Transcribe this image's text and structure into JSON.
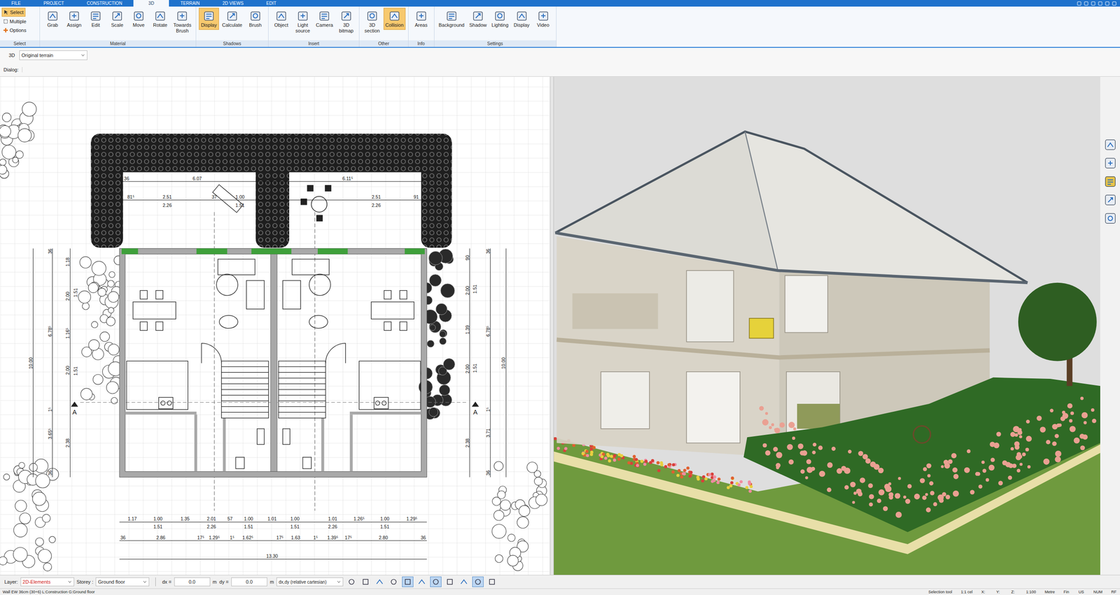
{
  "menu_tabs": [
    {
      "label": "FILE",
      "selected": false
    },
    {
      "label": "PROJECT",
      "selected": false
    },
    {
      "label": "CONSTRUCTION",
      "selected": false
    },
    {
      "label": "3D",
      "selected": true
    },
    {
      "label": "TERRAIN",
      "selected": false
    },
    {
      "label": "2D VIEWS",
      "selected": false
    },
    {
      "label": "EDIT",
      "selected": false
    }
  ],
  "ribbon": {
    "select_group": {
      "label": "Select",
      "items": [
        {
          "label": "Select",
          "selected": true
        },
        {
          "label": "Multiple",
          "selected": false
        },
        {
          "label": "Options",
          "selected": false
        }
      ]
    },
    "groups": [
      {
        "label": "Material",
        "buttons": [
          {
            "label": "Grab",
            "selected": false
          },
          {
            "label": "Assign",
            "selected": false
          },
          {
            "label": "Edit",
            "selected": false
          },
          {
            "label": "Scale",
            "selected": false
          },
          {
            "label": "Move",
            "selected": false
          },
          {
            "label": "Rotate",
            "selected": false
          },
          {
            "label": "Towards Brush",
            "selected": false
          }
        ]
      },
      {
        "label": "Shadows",
        "buttons": [
          {
            "label": "Display",
            "selected": true
          },
          {
            "label": "Calculate",
            "selected": false
          },
          {
            "label": "Brush",
            "selected": false
          }
        ]
      },
      {
        "label": "Insert",
        "buttons": [
          {
            "label": "Object",
            "selected": false
          },
          {
            "label": "Light source",
            "selected": false
          },
          {
            "label": "Camera",
            "selected": false
          },
          {
            "label": "3D bitmap",
            "selected": false
          }
        ]
      },
      {
        "label": "Other",
        "buttons": [
          {
            "label": "3D section",
            "selected": false
          },
          {
            "label": "Collision",
            "selected": true
          }
        ]
      },
      {
        "label": "Info",
        "buttons": [
          {
            "label": "Areas",
            "selected": false
          }
        ]
      },
      {
        "label": "Settings",
        "buttons": [
          {
            "label": "Background",
            "selected": false
          },
          {
            "label": "Shadow",
            "selected": false
          },
          {
            "label": "Lighting",
            "selected": false
          },
          {
            "label": "Display",
            "selected": false
          },
          {
            "label": "Video",
            "selected": false
          }
        ]
      }
    ]
  },
  "view_bar": {
    "label": "3D",
    "dropdown": "Original terrain"
  },
  "dialog": {
    "label": "Dialog:"
  },
  "plan": {
    "dimension_rows": [
      {
        "labels": [
          "36",
          "6.07",
          "6.11⁵"
        ]
      },
      {
        "labels": [
          "81⁵",
          "2.51",
          "37",
          "1.00",
          "2.51",
          "91"
        ]
      },
      {
        "labels": [
          "2.26",
          "1.51",
          "2.26"
        ]
      },
      {
        "labels": [
          "10.00"
        ]
      },
      {
        "labels": [
          "36",
          "6.78⁵",
          "1⁵",
          "3.65⁵",
          "36"
        ]
      },
      {
        "labels": [
          "1.18",
          "2.00",
          "1.16⁵",
          "2.00",
          "2.38"
        ]
      },
      {
        "labels": [
          "1.51",
          "1.51"
        ]
      },
      {
        "labels": [
          "90",
          "2.00",
          "1.39",
          "2.00",
          "2.38"
        ]
      },
      {
        "labels": [
          "1.51",
          "1.51"
        ]
      },
      {
        "labels": [
          "36",
          "6.78⁵",
          "1⁵",
          "3.71",
          "36"
        ]
      },
      {
        "labels": [
          "10.00"
        ]
      },
      {
        "labels": [
          "1.17",
          "1.00",
          "1.35",
          "2.01",
          "57",
          "1.00",
          "1.01",
          "1.00",
          "1.01",
          "1.26⁵",
          "1.00",
          "1.29⁵"
        ]
      },
      {
        "labels": [
          "1.51",
          "2.26",
          "1.51",
          "1.51",
          "2.26",
          "1.51"
        ]
      },
      {
        "labels": [
          "36",
          "2.86",
          "17⁵",
          "1.29⁵",
          "1⁵",
          "1.62⁵",
          "17⁵",
          "1.63",
          "1⁵",
          "1.39⁵",
          "17⁵",
          "2.80",
          "36"
        ]
      },
      {
        "labels": [
          "13.30"
        ]
      }
    ],
    "section_marks": [
      "A",
      "A"
    ]
  },
  "bottom_bar": {
    "layer_label": "Layer:",
    "layer": "2D-Elements",
    "storey_label": "Storey :",
    "storey": "Ground floor",
    "dx_label": "dx =",
    "dx": "0.0",
    "dx_unit": "m",
    "dy_label": "dy =",
    "dy": "0.0",
    "dy_unit": "m",
    "mode": "dx,dy (relative cartesian)",
    "tools": [
      {
        "selected": false
      },
      {
        "selected": false
      },
      {
        "selected": false
      },
      {
        "selected": false
      },
      {
        "selected": true
      },
      {
        "selected": false
      },
      {
        "selected": true
      },
      {
        "selected": false
      },
      {
        "selected": false
      },
      {
        "selected": true
      },
      {
        "selected": false
      }
    ]
  },
  "status_bar": {
    "left": "Wall EW 36cm (30+6) L:Construction G:Ground floor",
    "right": [
      "Selection tool",
      "1:1 cel",
      "X:",
      "Y:",
      "Z:",
      "1:100",
      "Metre",
      "Fin",
      "US",
      "NUM",
      "RF"
    ]
  }
}
